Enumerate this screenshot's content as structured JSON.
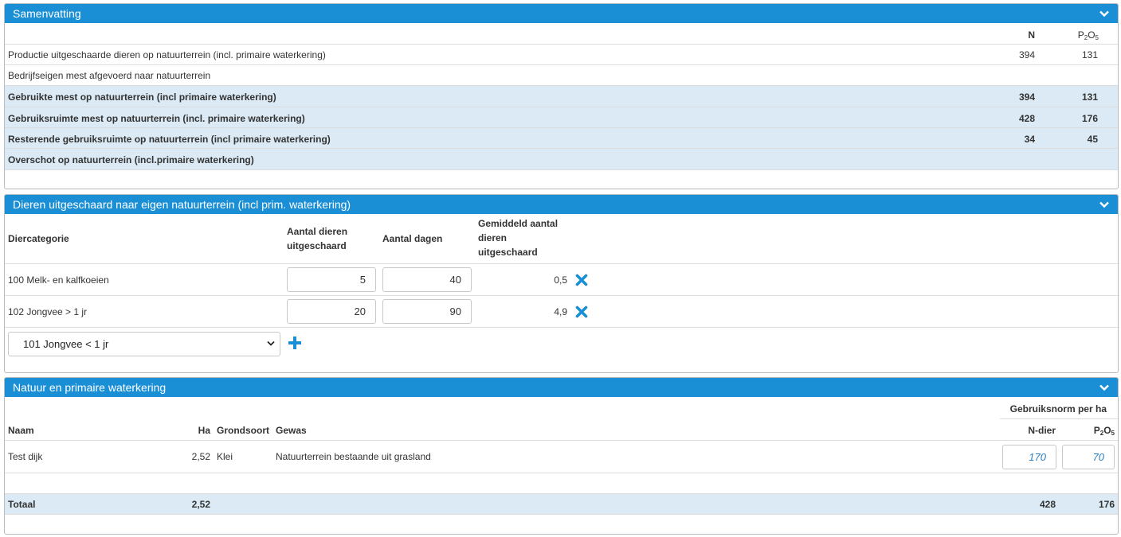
{
  "samenvatting": {
    "title": "Samenvatting",
    "col_n": "N",
    "col_p": "P",
    "col_p_sub1": "2",
    "col_p_mid": "O",
    "col_p_sub2": "5",
    "rows": [
      {
        "label": "Productie uitgeschaarde dieren op natuurterrein (incl. primaire waterkering)",
        "n": "394",
        "p": "131"
      },
      {
        "label": "Bedrijfseigen mest afgevoerd naar natuurterrein",
        "n": "",
        "p": ""
      },
      {
        "label": "Gebruikte mest op natuurterrein (incl primaire waterkering)",
        "n": "394",
        "p": "131"
      },
      {
        "label": "Gebruiksruimte mest op natuurterrein (incl. primaire waterkering)",
        "n": "428",
        "p": "176"
      },
      {
        "label": "Resterende gebruiksruimte op natuurterrein (incl primaire waterkering)",
        "n": "34",
        "p": "45"
      },
      {
        "label": "Overschot op natuurterrein (incl.primaire waterkering)",
        "n": "",
        "p": ""
      }
    ]
  },
  "dieren": {
    "title": "Dieren uitgeschaard naar eigen natuurterrein (incl prim. waterkering)",
    "col_cat": "Diercategorie",
    "col_aantal_1": "Aantal dieren",
    "col_aantal_2": "uitgeschaard",
    "col_dagen": "Aantal dagen",
    "col_gem_1": "Gemiddeld aantal",
    "col_gem_2": "dieren",
    "col_gem_3": "uitgeschaard",
    "rows": [
      {
        "cat": "100 Melk- en kalfkoeien",
        "aantal": "5",
        "dagen": "40",
        "gem": "0,5"
      },
      {
        "cat": "102 Jongvee > 1 jr",
        "aantal": "20",
        "dagen": "90",
        "gem": "4,9"
      }
    ],
    "select_value": "101 Jongvee < 1 jr"
  },
  "natuur": {
    "title": "Natuur en primaire waterkering",
    "group_header": "Gebruiksnorm per ha",
    "col_naam": "Naam",
    "col_ha": "Ha",
    "col_grond": "Grondsoort",
    "col_gewas": "Gewas",
    "col_ndier": "N-dier",
    "col_p": "P",
    "col_p_sub1": "2",
    "col_p_mid": "O",
    "col_p_sub2": "5",
    "rows": [
      {
        "naam": "Test dijk",
        "ha": "2,52",
        "grond": "Klei",
        "gewas": "Natuurterrein bestaande uit grasland",
        "ndier": "170",
        "p": "70"
      }
    ],
    "totaal": {
      "label": "Totaal",
      "ha": "2,52",
      "n": "428",
      "p": "176"
    }
  },
  "colors": {
    "header": "#1a8fd6",
    "highlight": "#dbeaf5",
    "icon": "#1a8fd6"
  }
}
